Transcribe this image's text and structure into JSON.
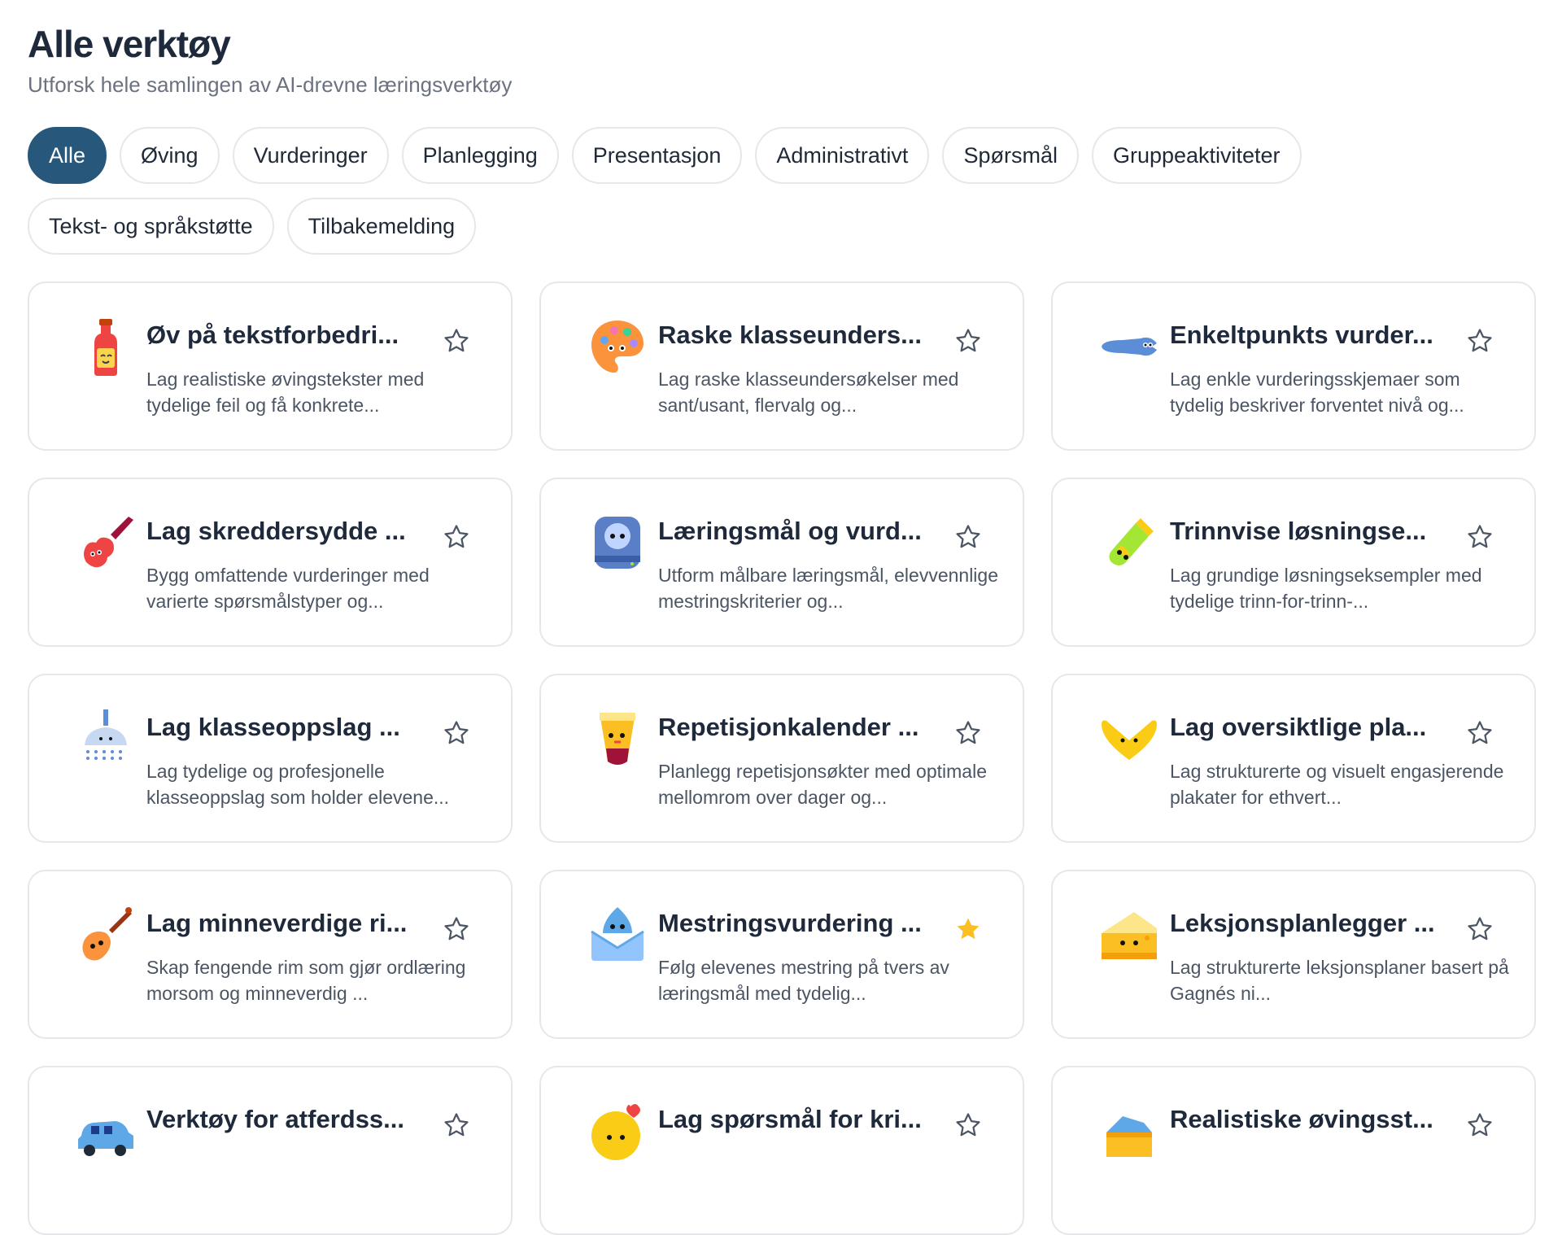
{
  "header": {
    "title": "Alle verktøy",
    "subtitle": "Utforsk hele samlingen av AI-drevne læringsverktøy"
  },
  "filters": [
    {
      "label": "Alle",
      "active": true
    },
    {
      "label": "Øving",
      "active": false
    },
    {
      "label": "Vurderinger",
      "active": false
    },
    {
      "label": "Planlegging",
      "active": false
    },
    {
      "label": "Presentasjon",
      "active": false
    },
    {
      "label": "Administrativt",
      "active": false
    },
    {
      "label": "Spørsmål",
      "active": false
    },
    {
      "label": "Gruppeaktiviteter",
      "active": false
    },
    {
      "label": "Tekst- og språkstøtte",
      "active": false
    },
    {
      "label": "Tilbakemelding",
      "active": false
    }
  ],
  "tools": [
    {
      "title": "Øv på tekstforbedri...",
      "desc": "Lag realistiske øvingstekster med tydelige feil og få konkrete...",
      "icon": "bottle-icon",
      "favorite": false
    },
    {
      "title": "Raske klasseunders...",
      "desc": "Lag raske klasseundersøkelser med sant/usant, flervalg og...",
      "icon": "palette-icon",
      "favorite": false
    },
    {
      "title": "Enkeltpunkts vurder...",
      "desc": "Lag enkle vurderingsskjemaer som tydelig beskriver forventet nivå og...",
      "icon": "fish-icon",
      "favorite": false
    },
    {
      "title": "Lag skreddersydde ...",
      "desc": "Bygg omfattende vurderinger med varierte spørsmålstyper og...",
      "icon": "guitar-icon",
      "favorite": false
    },
    {
      "title": "Læringsmål og vurd...",
      "desc": "Utform målbare læringsmål, elevvennlige mestringskriterier og...",
      "icon": "radio-icon",
      "favorite": false
    },
    {
      "title": "Trinnvise løsningse...",
      "desc": "Lag grundige løsningseksempler med tydelige trinn-for-trinn-...",
      "icon": "champagne-icon",
      "favorite": false
    },
    {
      "title": "Lag klasseoppslag ...",
      "desc": "Lag tydelige og profesjonelle klasseoppslag som holder elevene...",
      "icon": "shower-icon",
      "favorite": false
    },
    {
      "title": "Repetisjonkalender ...",
      "desc": "Planlegg repetisjonsøkter med optimale mellomrom over dager og...",
      "icon": "drink-icon",
      "favorite": false
    },
    {
      "title": "Lag oversiktlige pla...",
      "desc": "Lag strukturerte og visuelt engasjerende plakater for ethvert...",
      "icon": "heart-hands-icon",
      "favorite": false
    },
    {
      "title": "Lag minneverdige ri...",
      "desc": "Skap fengende rim som gjør ordlæring morsom og minneverdig ...",
      "icon": "ukulele-icon",
      "favorite": false
    },
    {
      "title": "Mestringsvurdering ...",
      "desc": "Følg elevenes mestring på tvers av læringsmål med tydelig...",
      "icon": "mail-icon",
      "favorite": true
    },
    {
      "title": "Leksjonsplanlegger ...",
      "desc": "Lag strukturerte leksjonsplaner basert på Gagnés ni...",
      "icon": "cheese-icon",
      "favorite": false
    },
    {
      "title": "Verktøy for atferdss...",
      "desc": "",
      "icon": "car-icon",
      "favorite": false
    },
    {
      "title": "Lag spørsmål for kri...",
      "desc": "",
      "icon": "smiley-heart-icon",
      "favorite": false
    },
    {
      "title": "Realistiske øvingsst...",
      "desc": "",
      "icon": "box-icon",
      "favorite": false
    }
  ],
  "colors": {
    "active_chip": "#27577a",
    "star_filled": "#fbbf24",
    "star_outline": "#4b5563"
  }
}
